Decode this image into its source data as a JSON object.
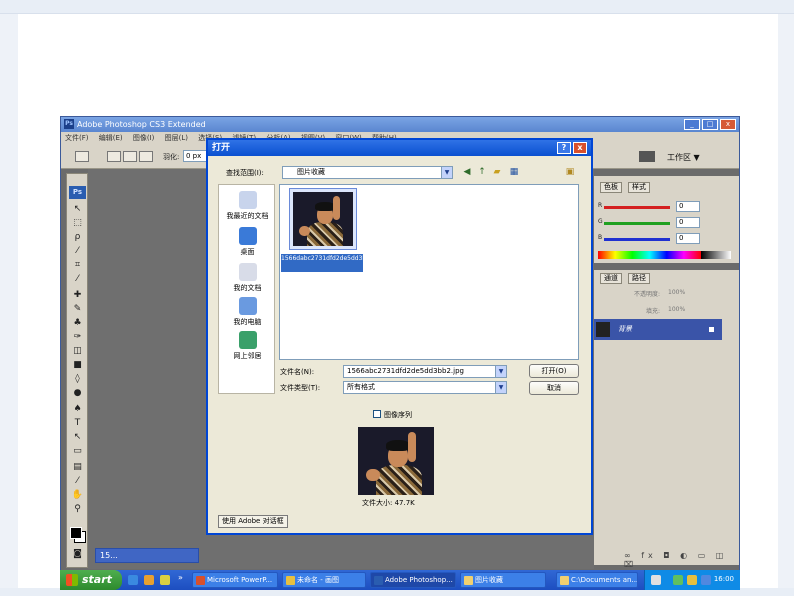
{
  "photoshop": {
    "window_title": "Adobe Photoshop CS3 Extended",
    "menus": [
      "文件(F)",
      "编辑(E)",
      "图像(I)",
      "图层(L)",
      "选择(S)",
      "滤镜(T)",
      "分析(A)",
      "视图(V)",
      "窗口(W)",
      "帮助(H)"
    ],
    "feather_label": "羽化:",
    "feather_value": "0 px",
    "workspace_label": "工作区 ▼",
    "tool_ps_label": "Ps",
    "minimized_doc": "15..."
  },
  "panels": {
    "color_tabs": [
      "色板",
      "样式"
    ],
    "sliders": [
      {
        "letter": "R",
        "value": "0",
        "color": "#d42020"
      },
      {
        "letter": "G",
        "value": "0",
        "color": "#20a020"
      },
      {
        "letter": "B",
        "value": "0",
        "color": "#2030d0"
      }
    ],
    "layer_tabs": [
      "通道",
      "路径"
    ],
    "opacity_label": "不透明度:",
    "opacity_value": "100%",
    "fill_label": "填充:",
    "fill_value": "100%",
    "layer_name": "背景",
    "footer_icons": "∞ fx ◘ ◐ ▭ ◫ ⌧"
  },
  "dialog": {
    "title": "打开",
    "look_in_label": "查找范围(I):",
    "look_in_value": "图片收藏",
    "places": [
      "我最近的文档",
      "桌面",
      "我的文档",
      "我的电脑",
      "网上邻居"
    ],
    "file_item_name": "1566dabc2731dfd2de5dd3bb2.jpg",
    "filename_label": "文件名(N):",
    "filename_value": "1566abc2731dfd2de5dd3bb2.jpg",
    "filetype_label": "文件类型(T):",
    "filetype_value": "所有格式",
    "open_button": "打开(O)",
    "cancel_button": "取消",
    "image_sequence_label": "图像序列",
    "file_size": "文件大小: 47.7K",
    "adobe_dialog_button": "使用 Adobe 对话框"
  },
  "taskbar": {
    "start_label": "start",
    "buttons": [
      "Microsoft PowerP...",
      "未命名 - 画图",
      "Adobe Photoshop...",
      "图片收藏",
      "C:\\Documents an..."
    ],
    "clock": "16:00"
  }
}
